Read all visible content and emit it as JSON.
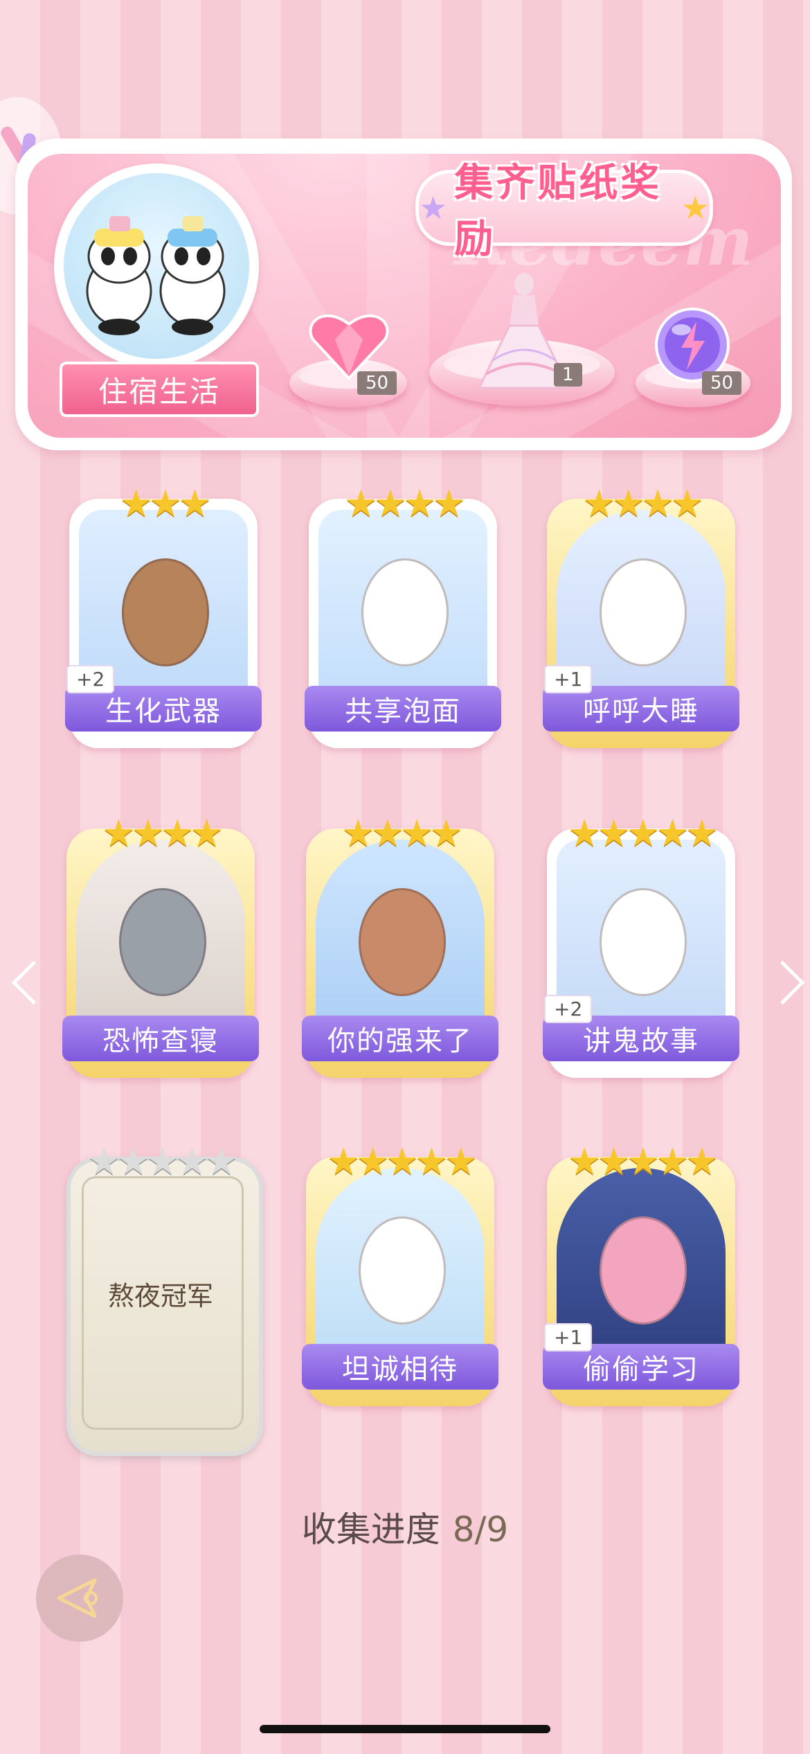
{
  "header": {
    "title": "集齐贴纸奖励",
    "watermark": "Redeem",
    "set_name": "住宿生活",
    "rewards": [
      {
        "name": "heart-gem-icon",
        "count": "50"
      },
      {
        "name": "gown-icon",
        "count": "1"
      },
      {
        "name": "energy-orb-icon",
        "count": "50"
      }
    ]
  },
  "cards": [
    {
      "label": "生化武器",
      "stars": 3,
      "bonus": "+2",
      "frame": "white"
    },
    {
      "label": "共享泡面",
      "stars": 4,
      "bonus": "",
      "frame": "white"
    },
    {
      "label": "呼呼大睡",
      "stars": 4,
      "bonus": "+1",
      "frame": "gold"
    },
    {
      "label": "恐怖查寝",
      "stars": 4,
      "bonus": "",
      "frame": "gold"
    },
    {
      "label": "你的强来了",
      "stars": 4,
      "bonus": "",
      "frame": "gold"
    },
    {
      "label": "讲鬼故事",
      "stars": 5,
      "bonus": "+2",
      "frame": "white"
    },
    {
      "label": "熬夜冠军",
      "stars": 5,
      "bonus": "",
      "frame": "locked"
    },
    {
      "label": "坦诚相待",
      "stars": 5,
      "bonus": "",
      "frame": "gold"
    },
    {
      "label": "偷偷学习",
      "stars": 5,
      "bonus": "+1",
      "frame": "gold"
    }
  ],
  "progress": {
    "label": "收集进度",
    "value": "8/9"
  },
  "colors": {
    "accent": "#ff5f8f",
    "ribbon": "#8d67e2",
    "star": "#f7c62b"
  }
}
